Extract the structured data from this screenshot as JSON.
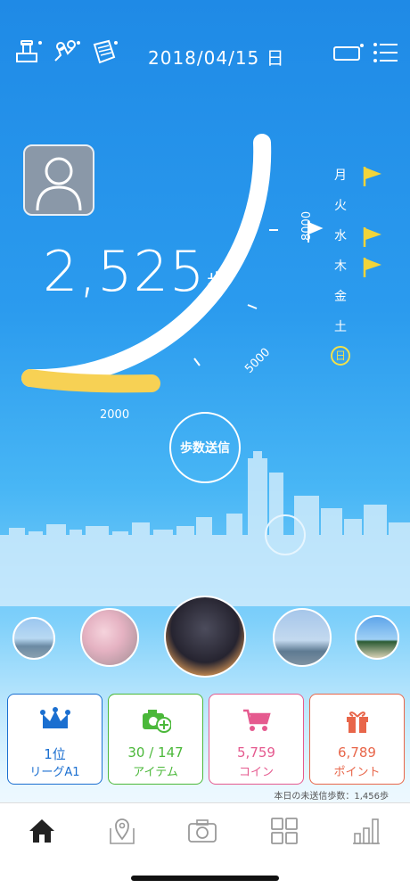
{
  "header": {
    "date": "2018/04/15 日",
    "icons": [
      "stamp-icon",
      "route-map-icon",
      "scroll-icon"
    ],
    "right_icons": [
      "device-battery-icon",
      "menu-list-icon"
    ]
  },
  "gauge": {
    "steps": "2,525",
    "steps_unit": "歩",
    "tick_labels": [
      "2000",
      "5000",
      "8000"
    ],
    "progress_fraction": 0.2,
    "colors": {
      "progress": "#f7d154",
      "track": "#ffffff"
    }
  },
  "weekdays": [
    {
      "label": "月",
      "flag": true,
      "today": false
    },
    {
      "label": "火",
      "flag": true,
      "today": false
    },
    {
      "label": "水",
      "flag": true,
      "today": false
    },
    {
      "label": "木",
      "flag": true,
      "today": false
    },
    {
      "label": "金",
      "flag": false,
      "today": false
    },
    {
      "label": "土",
      "flag": false,
      "today": false
    },
    {
      "label": "日",
      "flag": false,
      "today": true
    }
  ],
  "send_button": {
    "label": "歩数送信"
  },
  "cards": [
    {
      "line1": "1位",
      "line2": "リーグA1",
      "icon": "crown-icon",
      "color": "#1b6fd0"
    },
    {
      "line1": "30 / 147",
      "line2": "アイテム",
      "icon": "camera-add-icon",
      "color": "#4bb83a"
    },
    {
      "line1": "5,759",
      "line2": "コイン",
      "icon": "cart-icon",
      "color": "#e55a8f"
    },
    {
      "line1": "6,789",
      "line2": "ポイント",
      "icon": "gift-icon",
      "color": "#e8664a"
    }
  ],
  "unsent": "本日の未送信歩数：1,456歩",
  "tabs": [
    "home-tab",
    "map-tab",
    "camera-tab",
    "grid-tab",
    "stats-tab"
  ]
}
